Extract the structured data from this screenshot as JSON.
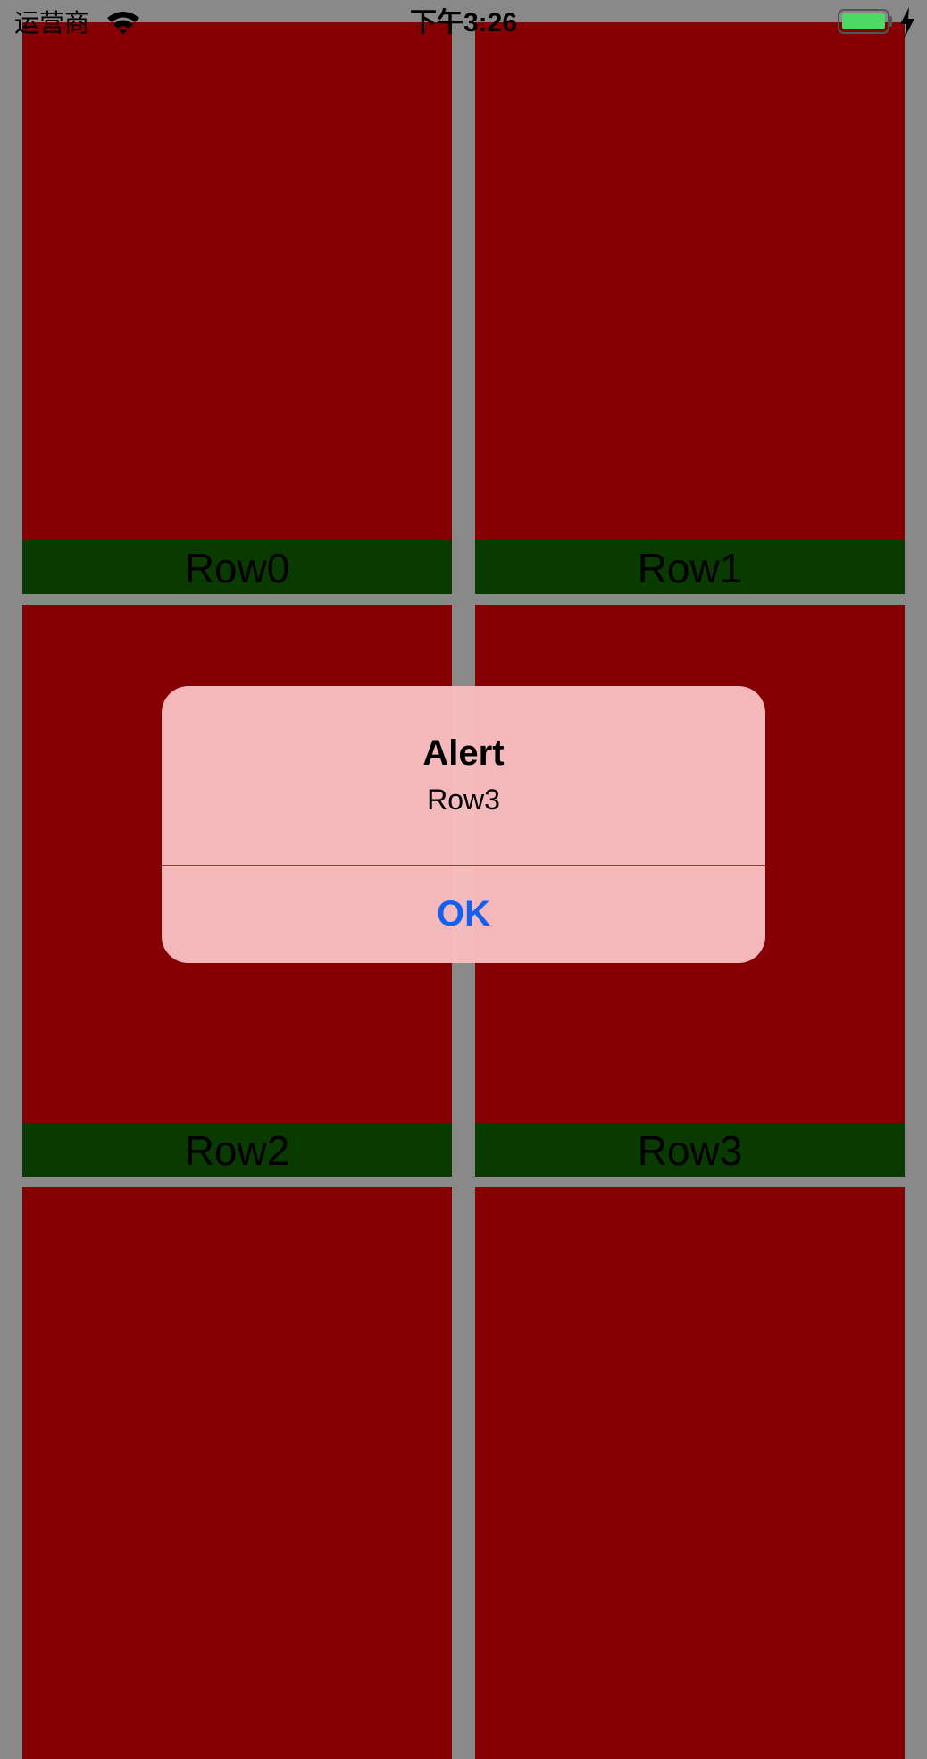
{
  "status_bar": {
    "carrier": "运营商",
    "time": "下午3:26",
    "wifi_icon": "wifi-icon",
    "battery_icon": "battery-icon",
    "charging_icon": "charging-bolt-icon",
    "battery_color": "#4cd964"
  },
  "grid": {
    "cells": [
      {
        "label": "Row0"
      },
      {
        "label": "Row1"
      },
      {
        "label": "Row2"
      },
      {
        "label": "Row3"
      },
      {
        "label": ""
      },
      {
        "label": ""
      }
    ],
    "cell_color": "#850002",
    "label_bar_color": "#093b00"
  },
  "alert": {
    "title": "Alert",
    "message": "Row3",
    "ok_label": "OK",
    "background_color": "#f9bec0",
    "button_color": "#1560f0"
  }
}
